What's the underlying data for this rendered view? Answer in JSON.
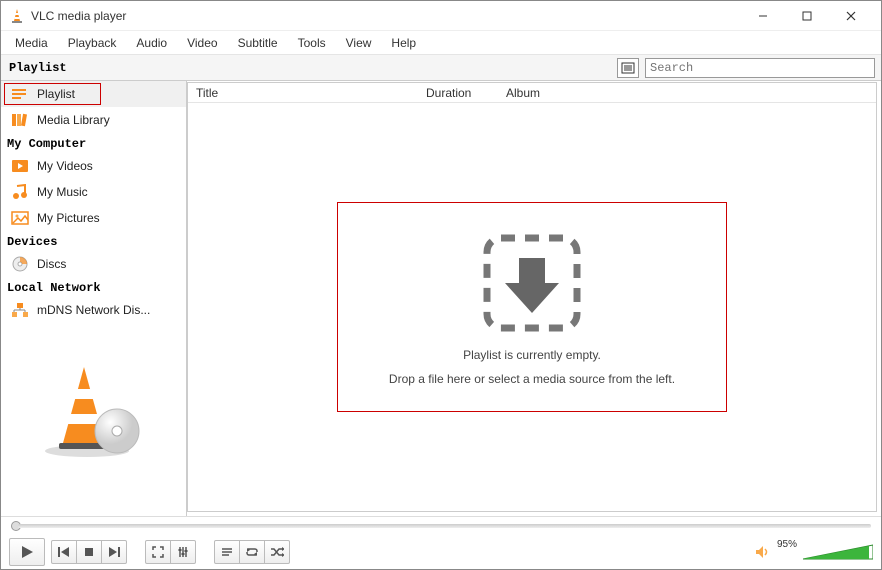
{
  "window": {
    "title": "VLC media player"
  },
  "menubar": [
    "Media",
    "Playback",
    "Audio",
    "Video",
    "Subtitle",
    "Tools",
    "View",
    "Help"
  ],
  "playlist_header": {
    "label": "Playlist",
    "search_placeholder": "Search"
  },
  "sidebar": {
    "groups": [
      {
        "header": "",
        "items": [
          {
            "label": "Playlist",
            "icon": "playlist"
          },
          {
            "label": "Media Library",
            "icon": "medialib"
          }
        ]
      },
      {
        "header": "My Computer",
        "items": [
          {
            "label": "My Videos",
            "icon": "video"
          },
          {
            "label": "My Music",
            "icon": "music"
          },
          {
            "label": "My Pictures",
            "icon": "pictures"
          }
        ]
      },
      {
        "header": "Devices",
        "items": [
          {
            "label": "Discs",
            "icon": "disc"
          }
        ]
      },
      {
        "header": "Local Network",
        "items": [
          {
            "label": "mDNS Network Dis...",
            "icon": "network"
          }
        ]
      }
    ]
  },
  "columns": {
    "title": "Title",
    "duration": "Duration",
    "album": "Album"
  },
  "empty_state": {
    "line1": "Playlist is currently empty.",
    "line2": "Drop a file here or select a media source from the left."
  },
  "volume": {
    "percent_label": "95%"
  }
}
